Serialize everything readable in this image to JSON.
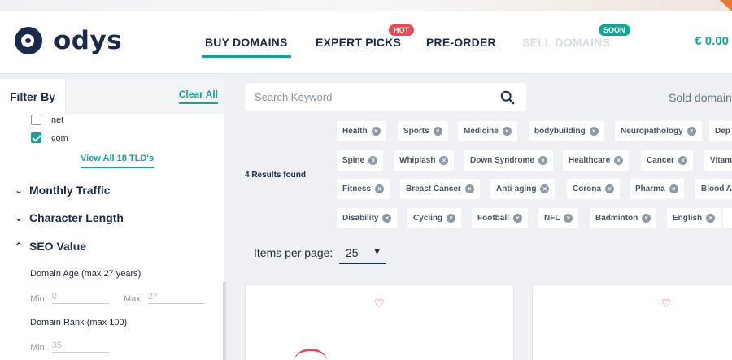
{
  "brand": {
    "name": "odys"
  },
  "nav": {
    "buy": "BUY DOMAINS",
    "expert": "EXPERT PICKS",
    "hot_badge": "HOT",
    "preorder": "PRE-ORDER",
    "sell": "SELL DOMAINS",
    "soon_badge": "SOON",
    "balance": "€ 0.00"
  },
  "sidebar": {
    "title": "Filter By",
    "clear_all": "Clear All",
    "tlds": [
      {
        "label": "net",
        "checked": false
      },
      {
        "label": "com",
        "checked": true
      }
    ],
    "view_all": "View All 18 TLD's",
    "sections": [
      {
        "label": "Monthly Traffic",
        "expanded": false
      },
      {
        "label": "Character Length",
        "expanded": false
      },
      {
        "label": "SEO Value",
        "expanded": true
      }
    ],
    "domain_age": {
      "label": "Domain Age (max 27 years)",
      "min_label": "Min:",
      "min_value": "0",
      "max_label": "Max:",
      "max_value": "27"
    },
    "domain_rank": {
      "label": "Domain Rank (max 100)",
      "min_label": "Min:",
      "min_value": "35"
    }
  },
  "search": {
    "placeholder": "Search Keyword",
    "icon": "search-icon"
  },
  "sold_label": "Sold domain",
  "results": "4 Results found",
  "chip_rows": [
    [
      "Health",
      "Sports",
      "Medicine",
      "bodybuilding",
      "Neuropathology",
      "Dep"
    ],
    [
      "Spine",
      "Whiplash",
      "Down Syndrome",
      "Healthcare",
      "Cancer",
      "Vitam"
    ],
    [
      "Fitness",
      "Breast Cancer",
      "Anti-aging",
      "Corona",
      "Pharma",
      "Blood A"
    ],
    [
      "Disability",
      "Cycling",
      "Football",
      "NFL",
      "Badminton",
      "English",
      ""
    ]
  ],
  "items_per_page": {
    "label": "Items per page:",
    "value": "25"
  },
  "colors": {
    "accent": "#16a394",
    "navy": "#1b2a4a",
    "hot": "#ea4a55",
    "heart": "#e74a5f"
  }
}
